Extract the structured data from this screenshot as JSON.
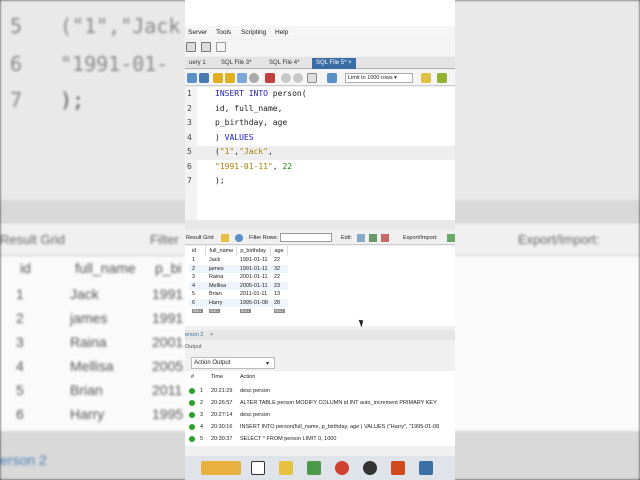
{
  "background": {
    "code_lines": [
      {
        "num": "5",
        "text": "(\"1\",\"Jack"
      },
      {
        "num": "6",
        "text": "\"1991-01-"
      },
      {
        "num": "7",
        "text": ");"
      }
    ],
    "result_grid_label": "Result Grid",
    "filter_label": "Filter",
    "export_label": "Export/Import:",
    "col_headers": [
      "id",
      "full_name",
      "p_bi"
    ],
    "rows": [
      [
        "1",
        "Jack",
        "1991"
      ],
      [
        "2",
        "james",
        "1991"
      ],
      [
        "3",
        "Raina",
        "2001"
      ],
      [
        "4",
        "Mellisa",
        "2005"
      ],
      [
        "5",
        "Brian",
        "2011"
      ],
      [
        "6",
        "Harry",
        "1995"
      ]
    ],
    "null_label": "NULL",
    "tab_label": "erson 2"
  },
  "menu": {
    "items": [
      "Server",
      "Tools",
      "Scripting",
      "Help"
    ]
  },
  "tabs": [
    {
      "label": "uery 1",
      "active": false
    },
    {
      "label": "SQL File 3*",
      "active": false
    },
    {
      "label": "SQL File 4*",
      "active": false
    },
    {
      "label": "SQL File 5*",
      "active": true
    }
  ],
  "query_toolbar": {
    "limit_label": "Limit to 1000 rows"
  },
  "editor": {
    "lines": [
      {
        "n": "1",
        "parts": [
          {
            "t": "INSERT INTO ",
            "k": "kw"
          },
          {
            "t": "person(",
            "k": ""
          }
        ]
      },
      {
        "n": "2",
        "parts": [
          {
            "t": "id, full_name,",
            "k": ""
          }
        ]
      },
      {
        "n": "3",
        "parts": [
          {
            "t": "p_birthday, age",
            "k": ""
          }
        ]
      },
      {
        "n": "4",
        "parts": [
          {
            "t": ") ",
            "k": ""
          },
          {
            "t": "VALUES",
            "k": "kw"
          }
        ]
      },
      {
        "n": "5",
        "parts": [
          {
            "t": "(",
            "k": ""
          },
          {
            "t": "\"1\"",
            "k": "st"
          },
          {
            "t": ",",
            "k": ""
          },
          {
            "t": "\"Jack\"",
            "k": "st"
          },
          {
            "t": ",",
            "k": ""
          }
        ]
      },
      {
        "n": "6",
        "parts": [
          {
            "t": "\"1991-01-11\"",
            "k": "st"
          },
          {
            "t": ", ",
            "k": ""
          },
          {
            "t": "22",
            "k": "nm"
          }
        ]
      },
      {
        "n": "7",
        "parts": [
          {
            "t": ");",
            "k": ""
          }
        ]
      }
    ]
  },
  "result_toolbar": {
    "result_grid": "Result Grid",
    "filter_rows": "Filter Rows:",
    "edit": "Edit:",
    "export": "Export/Import:"
  },
  "grid": {
    "headers": [
      "id",
      "full_name",
      "p_birthday",
      "age"
    ],
    "rows": [
      [
        "1",
        "Jack",
        "1991-01-11",
        "22"
      ],
      [
        "2",
        "james",
        "1991-01-11",
        "32"
      ],
      [
        "3",
        "Raina",
        "2001-01-11",
        "22"
      ],
      [
        "4",
        "Mellisa",
        "2005-01-11",
        "23"
      ],
      [
        "5",
        "Brian",
        "2011-01-11",
        "13"
      ],
      [
        "6",
        "Harry",
        "1995-01-08",
        "28"
      ]
    ],
    "null_label": "NULL"
  },
  "result_tab": "erson 2",
  "output": {
    "header": "Output",
    "selector": "Action Output",
    "columns": [
      "#",
      "Time",
      "Action"
    ],
    "rows": [
      {
        "num": "1",
        "time": "20:21:29",
        "action": "desc person"
      },
      {
        "num": "2",
        "time": "20:26:57",
        "action": "ALTER TABLE person MODIFY COLUMN id INT auto_increment PRIMARY KEY"
      },
      {
        "num": "3",
        "time": "20:27:14",
        "action": "desc person"
      },
      {
        "num": "4",
        "time": "20:30:16",
        "action": "INSERT INTO person(full_name, p_birthday, age ) VALUES (\"Harry\", \"1995-01-08"
      },
      {
        "num": "5",
        "time": "20:30:37",
        "action": "SELECT * FROM person LIMIT 0, 1000"
      }
    ]
  },
  "colors": {
    "accent": "#3a6ea5",
    "keyword": "#2020c0",
    "string": "#a67f00",
    "number": "#208020"
  }
}
